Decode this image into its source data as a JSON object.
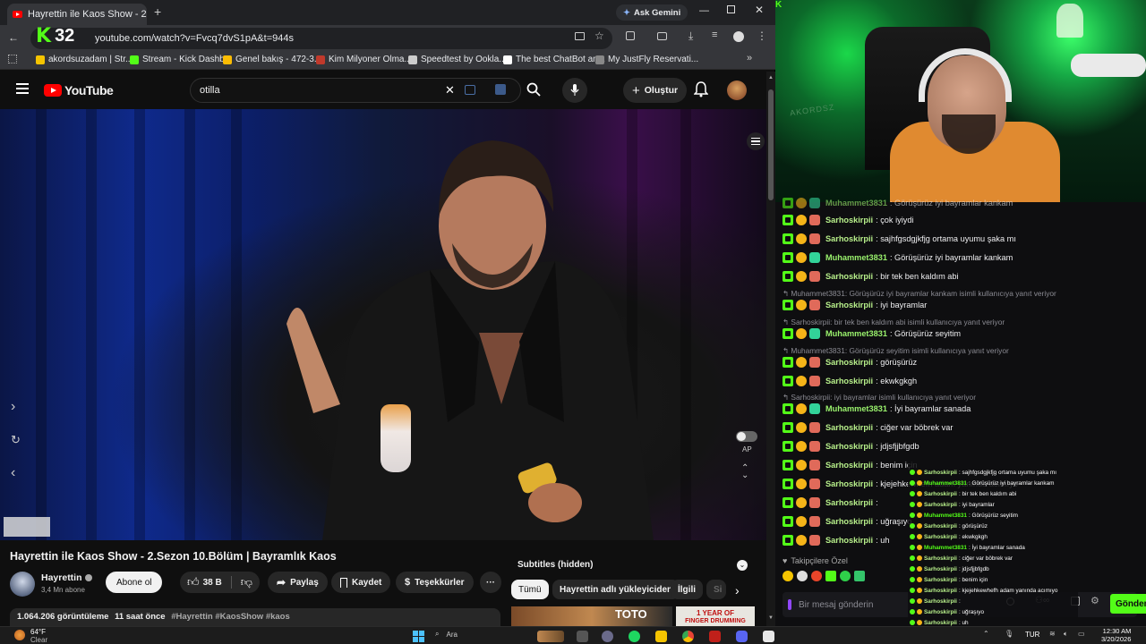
{
  "browser": {
    "tab_title": "Hayrettin ile Kaos Show - 2.",
    "new_tab": "+",
    "ask_gemini": "Ask Gemini",
    "url": "youtube.com/watch?v=Fvcq7dvS1pA&t=944s",
    "kick_counter": "32",
    "bookmarks": [
      {
        "label": "akordsuzadam | Str...",
        "color": "#f5c400"
      },
      {
        "label": "Stream - Kick Dashb...",
        "color": "#53fc18"
      },
      {
        "label": "Genel bakış - 472-3...",
        "color": "#fbbc04"
      },
      {
        "label": "Kim Milyoner Olma...",
        "color": "#c0392b"
      },
      {
        "label": "Speedtest by Ookla...",
        "color": "#cccccc"
      },
      {
        "label": "The best ChatBot an...",
        "color": "#ffffff"
      },
      {
        "label": "My JustFly Reservati...",
        "color": "#888888"
      }
    ]
  },
  "youtube": {
    "logo": "YouTube",
    "search_value": "otilla",
    "create_label": "Oluştur",
    "video_title": "Hayrettin ile Kaos Show - 2.Sezon 10.Bölüm | Bayramlık Kaos",
    "autoplay_label": "AP",
    "channel_name": "Hayrettin",
    "subscribers": "3,4 Mn abone",
    "subscribe_label": "Abone ol",
    "likes": "38 B",
    "share_label": "Paylaş",
    "save_label": "Kaydet",
    "thanks_label": "Teşekkürler",
    "views": "1.064.206 görüntüleme",
    "uploaded": "11 saat önce",
    "hashtags": "#Hayrettin #KaosShow #kaos",
    "subtitles": "Subtitles (hidden)",
    "chips": [
      "Tümü",
      "Hayrettin adlı yükleyiciden",
      "İlgili",
      "Si"
    ],
    "thumb_text_1": "TOTO",
    "thumb_text_2": "1 YEAR OF",
    "thumb_text_3": "FINGER DRUMMING"
  },
  "stream": {
    "wall_text": "AKORDSZ",
    "chat": [
      {
        "user": "Muhammet3831",
        "text": ": Görüşürüz iyi bayramlar kankam",
        "color": "green",
        "partial": true
      },
      {
        "user": "Sarhoskirpii",
        "text": ": çok iyiydi"
      },
      {
        "user": "Sarhoskirpii",
        "text": ": sajhfgsdgjkfjg ortama uyumu şaka mı"
      },
      {
        "user": "Muhammet3831",
        "text": ": Görüşürüz iyi bayramlar kankam",
        "color": "green"
      },
      {
        "user": "Sarhoskirpii",
        "text": ": bir tek ben kaldım abi"
      },
      {
        "user": "Sarhoskirpii",
        "text": ": iyi bayramlar"
      },
      {
        "user": "Muhammet3831",
        "text": ": Görüşürüz seyitim",
        "color": "green"
      },
      {
        "user": "Sarhoskirpii",
        "text": ": görüşürüz"
      },
      {
        "user": "Sarhoskirpii",
        "text": ": ekwkgkgh"
      },
      {
        "user": "Muhammet3831",
        "text": ": İyi bayramlar sanada",
        "color": "green"
      },
      {
        "user": "Sarhoskirpii",
        "text": ": ciğer var böbrek var"
      },
      {
        "user": "Sarhoskirpii",
        "text": ": jdjsfjjbfgdb"
      },
      {
        "user": "Sarhoskirpii",
        "text": ": benim için"
      },
      {
        "user": "Sarhoskirpii",
        "text": ": kjejehkewhefh adam yanında acımıyo"
      },
      {
        "user": "Sarhoskirpii",
        "text": ":"
      },
      {
        "user": "Sarhoskirpii",
        "text": ": uğraşıyo"
      },
      {
        "user": "Sarhoskirpii",
        "text": ": uh"
      }
    ],
    "replies": [
      "Muhammet3831: Görüşürüz iyi bayramlar kankam isimli kullanıcıya yanıt veriyor",
      "Sarhoskirpii: bir tek ben kaldım abi isimli kullanıcıya yanıt veriyor",
      "Muhammet3831: Görüşürüz seyitim isimli kullanıcıya yanıt veriyor",
      "Sarhoskirpii: iyi bayramlar isimli kullanıcıya yanıt veriyor"
    ],
    "overlay_chat": [
      {
        "user": "Sarhoskirpii",
        "text": ": sajhfgsdgjkfjg ortama uyumu şaka mı"
      },
      {
        "user": "Muhammet3831",
        "text": ": Görüşürüz iyi bayramlar kankam",
        "color": "green"
      },
      {
        "user": "Sarhoskirpii",
        "text": ": bir tek ben kaldım abi"
      },
      {
        "user": "Sarhoskirpii",
        "text": ": iyi bayramlar"
      },
      {
        "user": "Muhammet3831",
        "text": ": Görüşürüz seyitim",
        "color": "green"
      },
      {
        "user": "Sarhoskirpii",
        "text": ": görüşürüz"
      },
      {
        "user": "Sarhoskirpii",
        "text": ": ekwkgkgh"
      },
      {
        "user": "Muhammet3831",
        "text": ": İyi bayramlar sanada",
        "color": "green"
      },
      {
        "user": "Sarhoskirpii",
        "text": ": ciğer var böbrek var"
      },
      {
        "user": "Sarhoskirpii",
        "text": ": jdjsfjjbfgdb"
      },
      {
        "user": "Sarhoskirpii",
        "text": ": benim için"
      },
      {
        "user": "Sarhoskirpii",
        "text": ": kjejehkewhefh adam yanında acımıyo"
      },
      {
        "user": "Sarhoskirpii",
        "text": ":"
      },
      {
        "user": "Sarhoskirpii",
        "text": ": uğraşıyo"
      },
      {
        "user": "Sarhoskirpii",
        "text": ": uh"
      }
    ],
    "followers_only": "Takipçilere Özel",
    "message_placeholder": "Bir mesaj gönderin",
    "send_label": "Gönder"
  },
  "taskbar": {
    "temp": "64°F",
    "weather": "Clear",
    "search": "Ara",
    "lang": "TUR",
    "time": "12:30 AM",
    "date": "3/20/2026"
  }
}
